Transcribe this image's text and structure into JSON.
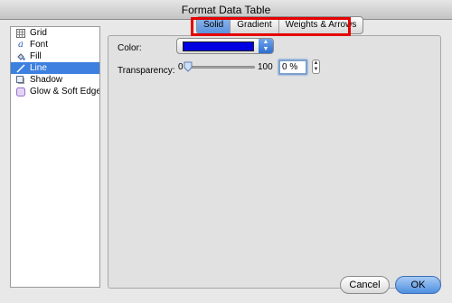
{
  "window": {
    "title": "Format Data Table"
  },
  "sidebar": {
    "items": [
      {
        "label": "Grid",
        "icon": "grid-icon",
        "selected": false
      },
      {
        "label": "Font",
        "icon": "font-icon",
        "selected": false
      },
      {
        "label": "Fill",
        "icon": "fill-bucket-icon",
        "selected": false
      },
      {
        "label": "Line",
        "icon": "line-icon",
        "selected": true
      },
      {
        "label": "Shadow",
        "icon": "shadow-icon",
        "selected": false
      },
      {
        "label": "Glow & Soft Edges",
        "icon": "glow-icon",
        "selected": false
      }
    ]
  },
  "tabs": [
    {
      "label": "Solid",
      "active": true
    },
    {
      "label": "Gradient",
      "active": false
    },
    {
      "label": "Weights & Arrows",
      "active": false
    }
  ],
  "color": {
    "label": "Color:",
    "value_hex": "#0000e0"
  },
  "transparency": {
    "label": "Transparency:",
    "min_label": "0",
    "max_label": "100",
    "value": 0,
    "field_text": "0 %"
  },
  "buttons": {
    "cancel": "Cancel",
    "ok": "OK"
  },
  "colors": {
    "selection": "#3d80df",
    "highlight": "#e60000",
    "swatch": "#0000e0"
  }
}
